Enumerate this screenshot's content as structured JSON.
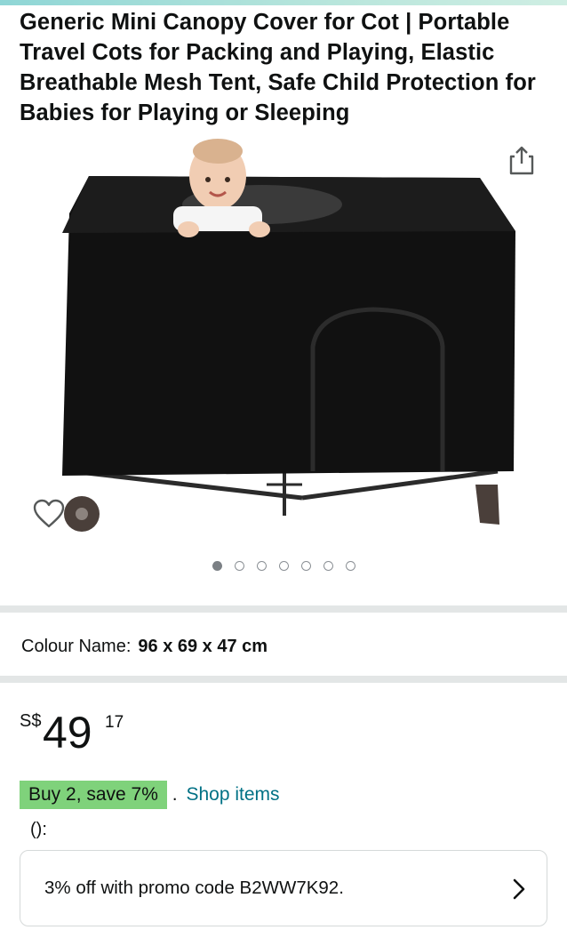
{
  "product": {
    "title": "Generic Mini Canopy Cover for Cot | Portable Travel Cots for Packing and Playing, Elastic Breathable Mesh Tent, Safe Child Protection for Babies for Playing or Sleeping",
    "image_icon": "product-photo",
    "image_count": 7,
    "active_image_index": 0
  },
  "icons": {
    "share": "share-icon",
    "wishlist": "heart-icon",
    "chevron": "chevron-right-icon"
  },
  "variation": {
    "label": "Colour Name:",
    "value": "96 x 69 x 47 cm"
  },
  "price": {
    "currency": "S$",
    "whole": "49",
    "fraction": "17"
  },
  "deal": {
    "badge": "Buy 2, save 7%",
    "separator": ".",
    "link": "Shop items"
  },
  "misc_text": "():",
  "promo": {
    "text": "3% off with promo code B2WW7K92."
  },
  "colors": {
    "link": "#007185",
    "deal_badge": "#7fd27b",
    "divider": "#e3e6e6"
  }
}
